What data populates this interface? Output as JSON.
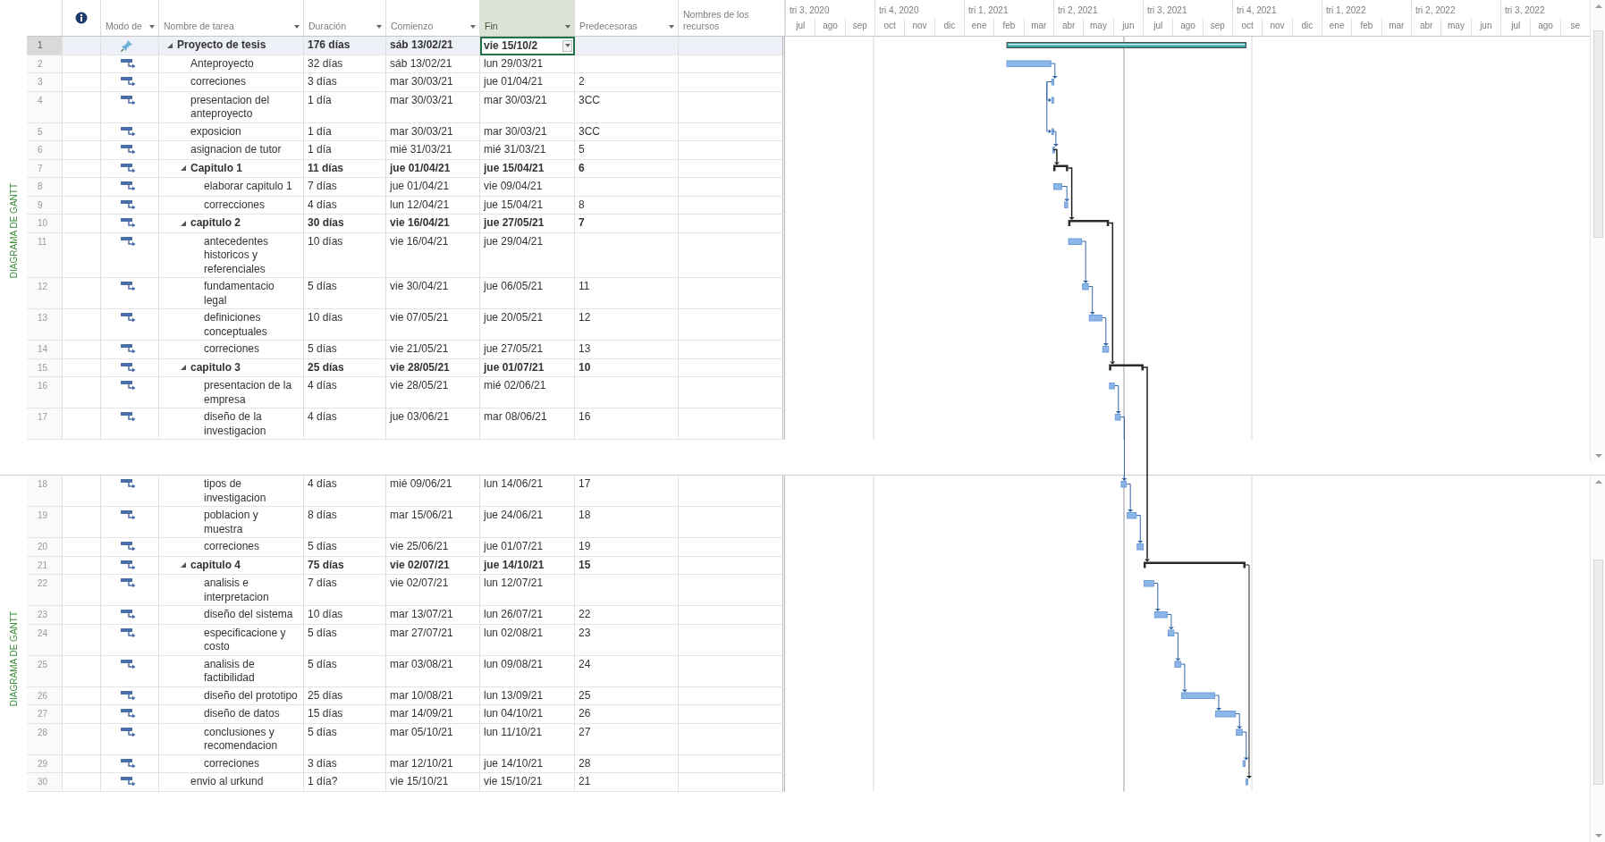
{
  "columns": [
    {
      "kind": "info",
      "has_menu": false,
      "selected": false
    },
    {
      "kind": "mode",
      "label": "Modo de",
      "has_menu": true,
      "selected": false
    },
    {
      "kind": "name",
      "label": "Nombre de tarea",
      "has_menu": true,
      "selected": false
    },
    {
      "kind": "duration",
      "label": "Duración",
      "has_menu": true,
      "selected": false
    },
    {
      "kind": "start",
      "label": "Comienzo",
      "has_menu": true,
      "selected": false
    },
    {
      "kind": "finish",
      "label": "Fin",
      "has_menu": true,
      "selected": true
    },
    {
      "kind": "predecessors",
      "label": "Predecesoras",
      "has_menu": true,
      "selected": false
    },
    {
      "kind": "resources",
      "label": "Nombres de los recursos",
      "has_menu": false,
      "selected": false
    }
  ],
  "timeline": [
    {
      "label": "tri 3, 2020",
      "months": [
        "jul",
        "ago",
        "sep"
      ]
    },
    {
      "label": "tri 4, 2020",
      "months": [
        "oct",
        "nov",
        "dic"
      ]
    },
    {
      "label": "tri 1, 2021",
      "months": [
        "ene",
        "feb",
        "mar"
      ]
    },
    {
      "label": "tri 2, 2021",
      "months": [
        "abr",
        "may",
        "jun"
      ]
    },
    {
      "label": "tri 3, 2021",
      "months": [
        "jul",
        "ago",
        "sep"
      ]
    },
    {
      "label": "tri 4, 2021",
      "months": [
        "oct",
        "nov",
        "dic"
      ]
    },
    {
      "label": "tri 1, 2022",
      "months": [
        "ene",
        "feb",
        "mar"
      ]
    },
    {
      "label": "tri 2, 2022",
      "months": [
        "abr",
        "may",
        "jun"
      ]
    },
    {
      "label": "tri 3, 2022",
      "months": [
        "jul",
        "ago",
        "se"
      ]
    }
  ],
  "panes": [
    {
      "side_label": "DIAGRAMA DE GANTT",
      "tasks": [
        {
          "id": "1",
          "manual": true,
          "kind": "summary",
          "expanded": true,
          "selected": true,
          "name": "Proyecto de tesis",
          "duration": "176 días",
          "start": "sáb 13/02/21",
          "finish": "vie 15/10/2",
          "children": [
            {
              "id": "2",
              "manual": false,
              "kind": "task",
              "selected": false,
              "name": "Anteproyecto",
              "duration": "32 días",
              "start": "sáb 13/02/21",
              "finish": "lun 29/03/21"
            },
            {
              "id": "3",
              "manual": false,
              "kind": "task",
              "selected": false,
              "name": "correciones",
              "duration": "3 días",
              "start": "mar 30/03/21",
              "finish": "jue 01/04/21",
              "predecessors": "2"
            },
            {
              "id": "4",
              "manual": false,
              "kind": "task",
              "selected": false,
              "name": "presentacion del anteproyecto",
              "duration": "1 día",
              "start": "mar 30/03/21",
              "finish": "mar 30/03/21",
              "predecessors": "3CC"
            },
            {
              "id": "5",
              "manual": false,
              "kind": "task",
              "selected": false,
              "name": "exposicion",
              "duration": "1 día",
              "start": "mar 30/03/21",
              "finish": "mar 30/03/21",
              "predecessors": "3CC"
            },
            {
              "id": "6",
              "manual": false,
              "kind": "task",
              "selected": false,
              "name": "asignacion de tutor",
              "duration": "1 día",
              "start": "mié 31/03/21",
              "finish": "mié 31/03/21",
              "predecessors": "5"
            },
            {
              "id": "7",
              "manual": false,
              "kind": "summary",
              "expanded": true,
              "selected": false,
              "name": "Capitulo 1",
              "duration": "11 días",
              "start": "jue 01/04/21",
              "finish": "jue 15/04/21",
              "predecessors": "6",
              "children": [
                {
                  "id": "8",
                  "manual": false,
                  "kind": "task",
                  "selected": false,
                  "name": "elaborar capitulo 1",
                  "duration": "7 días",
                  "start": "jue 01/04/21",
                  "finish": "vie 09/04/21"
                },
                {
                  "id": "9",
                  "manual": false,
                  "kind": "task",
                  "selected": false,
                  "name": "correcciones",
                  "duration": "4 días",
                  "start": "lun 12/04/21",
                  "finish": "jue 15/04/21",
                  "predecessors": "8"
                }
              ]
            },
            {
              "id": "10",
              "manual": false,
              "kind": "summary",
              "expanded": true,
              "selected": false,
              "name": "capitulo 2",
              "duration": "30 días",
              "start": "vie 16/04/21",
              "finish": "jue 27/05/21",
              "predecessors": "7",
              "children": [
                {
                  "id": "11",
                  "manual": false,
                  "kind": "task",
                  "selected": false,
                  "name": "antecedentes historicos y referenciales",
                  "duration": "10 días",
                  "start": "vie 16/04/21",
                  "finish": "jue 29/04/21"
                },
                {
                  "id": "12",
                  "manual": false,
                  "kind": "task",
                  "selected": false,
                  "name": "fundamentacio legal",
                  "duration": "5 días",
                  "start": "vie 30/04/21",
                  "finish": "jue 06/05/21",
                  "predecessors": "11"
                },
                {
                  "id": "13",
                  "manual": false,
                  "kind": "task",
                  "selected": false,
                  "name": "definiciones conceptuales",
                  "duration": "10 días",
                  "start": "vie 07/05/21",
                  "finish": "jue 20/05/21",
                  "predecessors": "12"
                },
                {
                  "id": "14",
                  "manual": false,
                  "kind": "task",
                  "selected": false,
                  "name": "correciones",
                  "duration": "5 días",
                  "start": "vie 21/05/21",
                  "finish": "jue 27/05/21",
                  "predecessors": "13"
                }
              ]
            },
            {
              "id": "15",
              "manual": false,
              "kind": "summary",
              "expanded": true,
              "selected": false,
              "name": "capitulo 3",
              "duration": "25 días",
              "start": "vie 28/05/21",
              "finish": "jue 01/07/21",
              "predecessors": "10",
              "children": [
                {
                  "id": "16",
                  "manual": false,
                  "kind": "task",
                  "selected": false,
                  "name": "presentacion de la empresa",
                  "duration": "4 días",
                  "start": "vie 28/05/21",
                  "finish": "mié 02/06/21"
                },
                {
                  "id": "17",
                  "manual": false,
                  "kind": "task",
                  "selected": false,
                  "name": "diseño de la investigacion",
                  "duration": "4 días",
                  "start": "jue 03/06/21",
                  "finish": "mar 08/06/21",
                  "predecessors": "16"
                }
              ]
            }
          ]
        }
      ]
    },
    {
      "side_label": "DIAGRAMA DE GANTT",
      "tasks": [
        {
          "children": [
            {
              "children": [
                {
                  "id": "18",
                  "manual": false,
                  "kind": "task",
                  "selected": false,
                  "name": "tipos de investigacion",
                  "duration": "4 días",
                  "start": "mié 09/06/21",
                  "finish": "lun 14/06/21",
                  "predecessors": "17"
                },
                {
                  "id": "19",
                  "manual": false,
                  "kind": "task",
                  "selected": false,
                  "name": "poblacion y muestra",
                  "duration": "8 días",
                  "start": "mar 15/06/21",
                  "finish": "jue 24/06/21",
                  "predecessors": "18"
                },
                {
                  "id": "20",
                  "manual": false,
                  "kind": "task",
                  "selected": false,
                  "name": "correciones",
                  "duration": "5 días",
                  "start": "vie 25/06/21",
                  "finish": "jue 01/07/21",
                  "predecessors": "19"
                }
              ]
            },
            {
              "id": "21",
              "manual": false,
              "kind": "summary",
              "expanded": true,
              "selected": false,
              "name": "capitulo 4",
              "duration": "75 días",
              "start": "vie 02/07/21",
              "finish": "jue 14/10/21",
              "predecessors": "15",
              "children": [
                {
                  "id": "22",
                  "manual": false,
                  "kind": "task",
                  "selected": false,
                  "name": "analisis e interpretacion",
                  "duration": "7 días",
                  "start": "vie 02/07/21",
                  "finish": "lun 12/07/21"
                },
                {
                  "id": "23",
                  "manual": false,
                  "kind": "task",
                  "selected": false,
                  "name": "diseño del sistema",
                  "duration": "10 días",
                  "start": "mar 13/07/21",
                  "finish": "lun 26/07/21",
                  "predecessors": "22"
                },
                {
                  "id": "24",
                  "manual": false,
                  "kind": "task",
                  "selected": false,
                  "name": "especificacione y costo",
                  "duration": "5 días",
                  "start": "mar 27/07/21",
                  "finish": "lun 02/08/21",
                  "predecessors": "23"
                },
                {
                  "id": "25",
                  "manual": false,
                  "kind": "task",
                  "selected": false,
                  "name": "analisis de factibilidad",
                  "duration": "5 días",
                  "start": "mar 03/08/21",
                  "finish": "lun 09/08/21",
                  "predecessors": "24"
                },
                {
                  "id": "26",
                  "manual": false,
                  "kind": "task",
                  "selected": false,
                  "name": "diseño del prototipo",
                  "duration": "25 días",
                  "start": "mar 10/08/21",
                  "finish": "lun 13/09/21",
                  "predecessors": "25"
                },
                {
                  "id": "27",
                  "manual": false,
                  "kind": "task",
                  "selected": false,
                  "name": "diseño de datos",
                  "duration": "15 días",
                  "start": "mar 14/09/21",
                  "finish": "lun 04/10/21",
                  "predecessors": "26"
                },
                {
                  "id": "28",
                  "manual": false,
                  "kind": "task",
                  "selected": false,
                  "name": "conclusiones y recomendacion",
                  "duration": "5 días",
                  "start": "mar 05/10/21",
                  "finish": "lun 11/10/21",
                  "predecessors": "27"
                },
                {
                  "id": "29",
                  "manual": false,
                  "kind": "task",
                  "selected": false,
                  "name": "correciones",
                  "duration": "3 días",
                  "start": "mar 12/10/21",
                  "finish": "jue 14/10/21",
                  "predecessors": "28"
                }
              ]
            },
            {
              "id": "30",
              "manual": false,
              "kind": "task",
              "selected": false,
              "name": "envio al urkund",
              "duration": "1 día?",
              "start": "vie 15/10/21",
              "finish": "vie 15/10/21",
              "predecessors": "21"
            }
          ]
        }
      ]
    }
  ]
}
